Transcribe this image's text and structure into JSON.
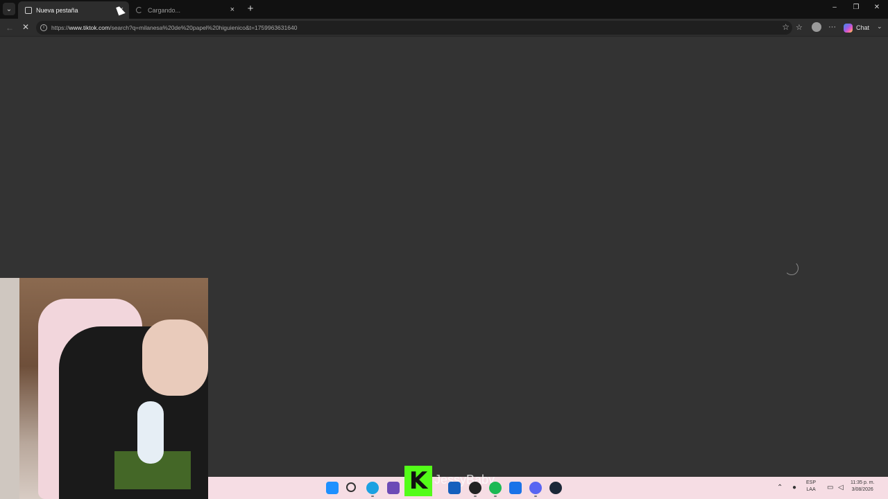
{
  "tabs": [
    {
      "label": "Nueva pestaña",
      "active": true,
      "close": "×"
    },
    {
      "label": "Cargando...",
      "active": false,
      "close": "×"
    }
  ],
  "tab_menu_glyph": "⌄",
  "new_tab_glyph": "+",
  "window_controls": {
    "minimize": "–",
    "restore": "❐",
    "close": "✕"
  },
  "nav": {
    "back": "←",
    "stop": "✕"
  },
  "address_bar": {
    "scheme": "https://",
    "host": "www.tiktok.com",
    "path": "/search?q=milanesa%20de%20papel%20higuienico&t=1759963631640"
  },
  "toolbar": {
    "chat_label": "Chat",
    "more_glyph": "···",
    "chevron": "⌄"
  },
  "stream_overlay": {
    "name": "JessyBaby",
    "logo_letter": "K"
  },
  "taskbar": {
    "language": "ESP",
    "layout": "LAA",
    "time": "11:35 p. m.",
    "date": "3/08/2026"
  },
  "colors": {
    "page_bg": "#333333",
    "tabbar_bg": "#111111",
    "toolbar_bg": "#2d2d2d",
    "taskbar_bg": "#f6dde4",
    "kick_green": "#53fc18"
  }
}
